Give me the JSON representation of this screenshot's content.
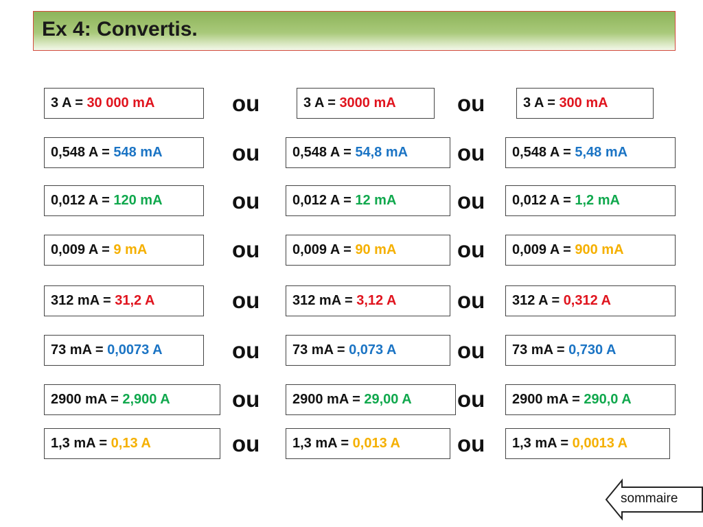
{
  "title": "Ex 4: Convertis.",
  "ou_label": "ou",
  "nav": {
    "label": "sommaire",
    "icon": "left-arrow-icon"
  },
  "colors": {
    "red": "#e0141e",
    "blue": "#1b74c4",
    "green": "#10a84d",
    "yellow": "#f5b000"
  },
  "rows": [
    {
      "lhs": "3 A = ",
      "color": "red",
      "answers": [
        "30 000 mA",
        "3000 mA",
        "300 mA"
      ],
      "lhs_list": [
        "3 A = ",
        "3 A = ",
        "3 A = "
      ]
    },
    {
      "color": "blue",
      "answers": [
        "548 mA",
        "54,8 mA",
        "5,48 mA"
      ],
      "lhs_list": [
        "0,548 A = ",
        "0,548 A = ",
        "0,548 A = "
      ]
    },
    {
      "color": "green",
      "answers": [
        "120 mA",
        "12 mA",
        "1,2 mA"
      ],
      "lhs_list": [
        "0,012 A = ",
        "0,012 A = ",
        "0,012 A = "
      ]
    },
    {
      "color": "yellow",
      "answers": [
        "9 mA",
        "90 mA",
        "900 mA"
      ],
      "lhs_list": [
        "0,009 A = ",
        "0,009 A = ",
        "0,009 A = "
      ]
    },
    {
      "color": "red",
      "answers": [
        "31,2 A",
        "3,12 A",
        "0,312 A"
      ],
      "lhs_list": [
        "312 mA = ",
        "312 mA = ",
        "312 A = "
      ]
    },
    {
      "color": "blue",
      "answers": [
        "0,0073 A",
        "0,073 A",
        "0,730 A"
      ],
      "lhs_list": [
        "73 mA = ",
        "73 mA = ",
        "73 mA = "
      ]
    },
    {
      "color": "green",
      "answers": [
        "2,900 A",
        "29,00 A",
        "290,0 A"
      ],
      "lhs_list": [
        "2900 mA = ",
        "2900 mA = ",
        "2900 mA = "
      ]
    },
    {
      "color": "yellow",
      "answers": [
        "0,13 A",
        "0,013 A",
        "0,0013 A"
      ],
      "lhs_list": [
        "1,3 mA = ",
        "1,3 mA = ",
        "1,3 mA = "
      ]
    }
  ]
}
